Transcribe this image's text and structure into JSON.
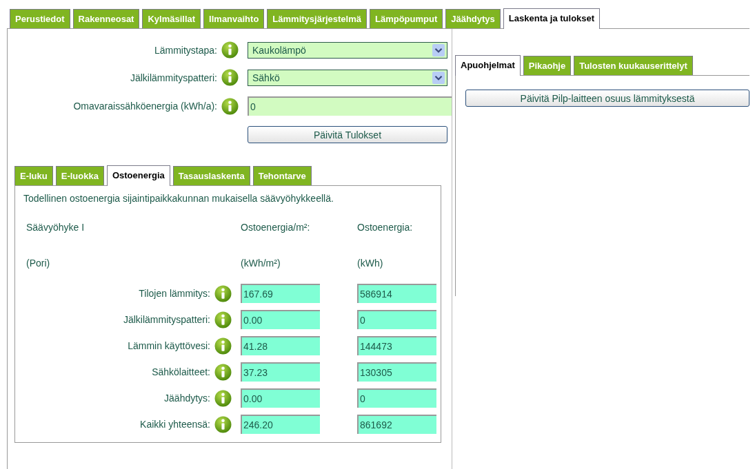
{
  "top_tabs": [
    {
      "label": "Perustiedot",
      "selected": false
    },
    {
      "label": "Rakenneosat",
      "selected": false
    },
    {
      "label": "Kylmäsillat",
      "selected": false
    },
    {
      "label": "Ilmanvaihto",
      "selected": false
    },
    {
      "label": "Lämmitysjärjestelmä",
      "selected": false
    },
    {
      "label": "Lämpöpumput",
      "selected": false
    },
    {
      "label": "Jäähdytys",
      "selected": false
    },
    {
      "label": "Laskenta ja tulokset",
      "selected": true
    }
  ],
  "form": {
    "fields": [
      {
        "label": "Lämmitystapa:",
        "kind": "select",
        "value": "Kaukolämpö"
      },
      {
        "label": "Jälkilämmityspatteri:",
        "kind": "select",
        "value": "Sähkö"
      },
      {
        "label": "Omavaraissähköenergia (kWh/a):",
        "kind": "input",
        "value": "0"
      }
    ],
    "button": "Päivitä Tulokset"
  },
  "result_tabs": [
    {
      "label": "E-luku",
      "selected": false
    },
    {
      "label": "E-luokka",
      "selected": false
    },
    {
      "label": "Ostoenergia",
      "selected": true
    },
    {
      "label": "Tasauslaskenta",
      "selected": false
    },
    {
      "label": "Tehontarve",
      "selected": false
    }
  ],
  "results": {
    "description": "Todellinen ostoenergia sijaintipaikkakunnan mukaisella säävyöhykkeellä.",
    "header": {
      "zone": "Säävyöhyke I",
      "column_1": "Ostoenergia/m²:",
      "column_2": "Ostoenergia:"
    },
    "subheader": {
      "location": "(Pori)",
      "unit_1": "(kWh/m²)",
      "unit_2": "(kWh)"
    },
    "rows": [
      {
        "label": "Tilojen lämmitys:",
        "per_m2": "167.69",
        "total": "586914"
      },
      {
        "label": "Jälkilämmityspatteri:",
        "per_m2": "0.00",
        "total": "0"
      },
      {
        "label": "Lämmin käyttövesi:",
        "per_m2": "41.28",
        "total": "144473"
      },
      {
        "label": "Sähkölaitteet:",
        "per_m2": "37.23",
        "total": "130305"
      },
      {
        "label": "Jäähdytys:",
        "per_m2": "0.00",
        "total": "0"
      },
      {
        "label": "Kaikki yhteensä:",
        "per_m2": "246.20",
        "total": "861692"
      }
    ]
  },
  "side_panel": {
    "tabs": [
      {
        "label": "Apuohjelmat",
        "selected": true
      },
      {
        "label": "Pikaohje",
        "selected": false
      },
      {
        "label": "Tulosten kuukauserittelyt",
        "selected": false
      }
    ],
    "button": "Päivitä Pilp-laitteen osuus lämmityksestä"
  }
}
